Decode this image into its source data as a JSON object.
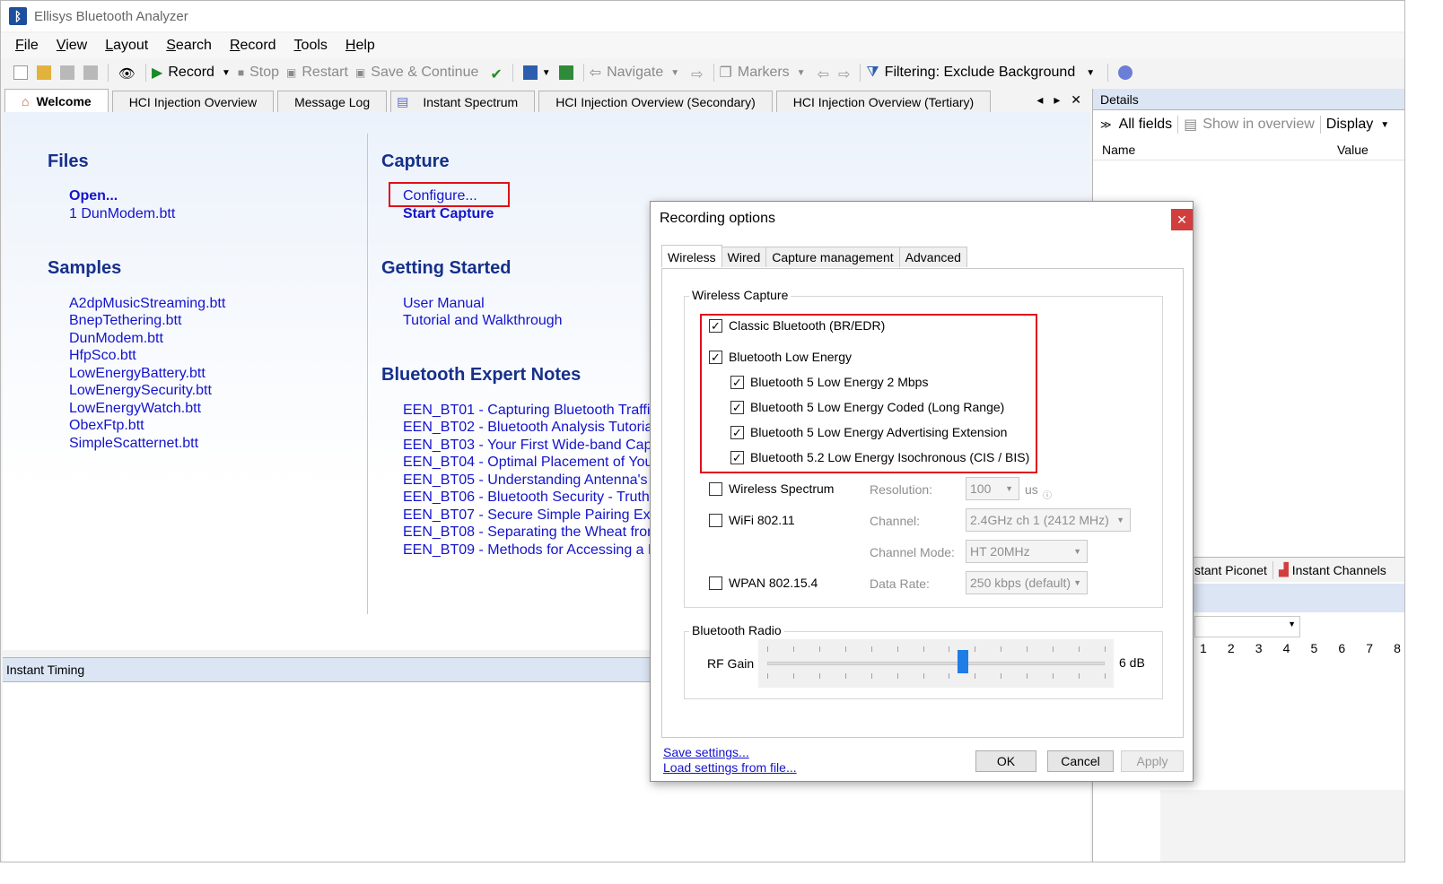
{
  "app": {
    "title": "Ellisys Bluetooth Analyzer"
  },
  "menu": [
    "File",
    "View",
    "Layout",
    "Search",
    "Record",
    "Tools",
    "Help"
  ],
  "toolbar": {
    "record": "Record",
    "stop": "Stop",
    "restart": "Restart",
    "save_continue": "Save & Continue",
    "navigate": "Navigate",
    "markers": "Markers",
    "filtering": "Filtering: Exclude Background"
  },
  "tabs": [
    "Welcome",
    "HCI Injection Overview",
    "Message Log",
    "Instant Spectrum",
    "HCI Injection Overview (Secondary)",
    "HCI Injection Overview (Tertiary)"
  ],
  "welcome": {
    "files": {
      "heading": "Files",
      "open": "Open...",
      "recent": "1 DunModem.btt"
    },
    "samples": {
      "heading": "Samples",
      "items": [
        "A2dpMusicStreaming.btt",
        "BnepTethering.btt",
        "DunModem.btt",
        "HfpSco.btt",
        "LowEnergyBattery.btt",
        "LowEnergySecurity.btt",
        "LowEnergyWatch.btt",
        "ObexFtp.btt",
        "SimpleScatternet.btt"
      ]
    },
    "capture": {
      "heading": "Capture",
      "configure": "Configure...",
      "start": "Start Capture"
    },
    "getting_started": {
      "heading": "Getting Started",
      "items": [
        "User Manual",
        "Tutorial and Walkthrough"
      ]
    },
    "notes": {
      "heading": "Bluetooth Expert Notes",
      "items": [
        "EEN_BT01 - Capturing Bluetooth Traffic,",
        "EEN_BT02 - Bluetooth Analysis Tutorial",
        "EEN_BT03 - Your First Wide-band Captu",
        "EEN_BT04 - Optimal Placement of Your",
        "EEN_BT05 - Understanding Antenna's R",
        "EEN_BT06 - Bluetooth Security - Truths",
        "EEN_BT07 - Secure Simple Pairing Expl",
        "EEN_BT08 - Separating the Wheat from",
        "EEN_BT09 - Methods for Accessing a Lin"
      ]
    }
  },
  "details": {
    "header": "Details",
    "all_fields": "All fields",
    "show_overview": "Show in overview",
    "display": "Display",
    "col_name": "Name",
    "col_value": "Value",
    "instant_piconet": "stant Piconet",
    "instant_channels": "Instant Channels",
    "channel_numbers": [
      "1",
      "2",
      "3",
      "4",
      "5",
      "6",
      "7",
      "8"
    ]
  },
  "instant_timing": "Instant Timing",
  "dialog": {
    "title": "Recording options",
    "tabs": [
      "Wireless",
      "Wired",
      "Capture management",
      "Advanced"
    ],
    "wireless_capture": "Wireless Capture",
    "classic": "Classic Bluetooth (BR/EDR)",
    "ble": "Bluetooth Low Energy",
    "ble_2m": "Bluetooth 5 Low Energy 2 Mbps",
    "ble_coded": "Bluetooth 5 Low Energy Coded (Long Range)",
    "ble_adv": "Bluetooth 5 Low Energy Advertising Extension",
    "ble_iso": "Bluetooth 5.2 Low Energy Isochronous (CIS / BIS)",
    "spectrum": "Wireless Spectrum",
    "resolution_label": "Resolution:",
    "resolution": "100",
    "resolution_unit": "us",
    "wifi": "WiFi 802.11",
    "channel_label": "Channel:",
    "channel": "2.4GHz ch 1 (2412 MHz)",
    "channel_mode_label": "Channel Mode:",
    "channel_mode": "HT 20MHz",
    "wpan": "WPAN 802.15.4",
    "data_rate_label": "Data Rate:",
    "data_rate": "250 kbps (default)",
    "bt_radio": "Bluetooth Radio",
    "rf_gain": "RF Gain",
    "rf_gain_value": "6 dB",
    "rf_gain_level": 0.58,
    "save_settings": "Save settings...",
    "load_settings": "Load settings from file...",
    "ok": "OK",
    "cancel": "Cancel",
    "apply": "Apply"
  }
}
